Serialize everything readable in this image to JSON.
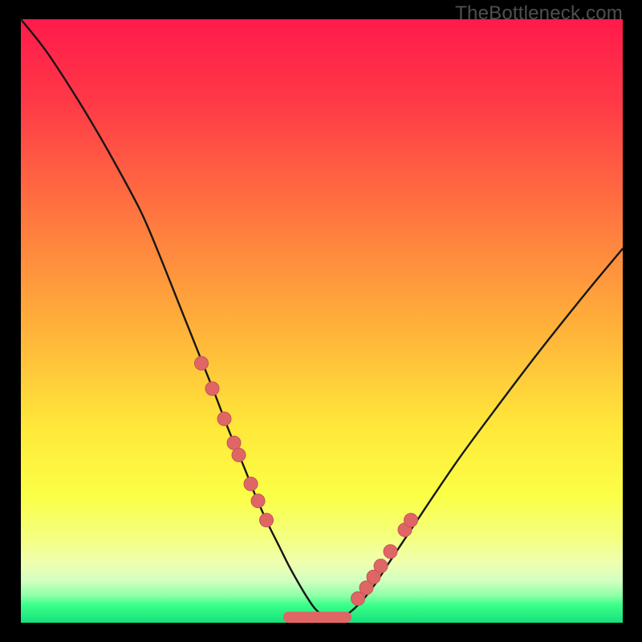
{
  "watermark": "TheBottleneck.com",
  "colors": {
    "frame_bg": "#000000",
    "gradient_stops": [
      {
        "pct": 0,
        "color": "#ff1a4b"
      },
      {
        "pct": 14,
        "color": "#ff3a47"
      },
      {
        "pct": 34,
        "color": "#ff7b3f"
      },
      {
        "pct": 52,
        "color": "#ffb43a"
      },
      {
        "pct": 68,
        "color": "#ffe93a"
      },
      {
        "pct": 79,
        "color": "#fbff46"
      },
      {
        "pct": 86,
        "color": "#f4ff80"
      },
      {
        "pct": 90,
        "color": "#efffaf"
      },
      {
        "pct": 93,
        "color": "#d3ffc1"
      },
      {
        "pct": 95.5,
        "color": "#8effa7"
      },
      {
        "pct": 97,
        "color": "#3dff8b"
      },
      {
        "pct": 100,
        "color": "#15e27a"
      }
    ],
    "curve_stroke": "#161616",
    "marker_fill": "#e06666",
    "marker_stroke": "#c25555",
    "flat_segment": "#e06666"
  },
  "chart_data": {
    "type": "line",
    "title": "",
    "xlabel": "",
    "ylabel": "",
    "xlim": [
      0,
      100
    ],
    "ylim": [
      0,
      100
    ],
    "grid": false,
    "legend": false,
    "series": [
      {
        "name": "bottleneck-curve",
        "x": [
          0,
          4,
          8,
          12,
          16,
          20,
          23,
          26,
          29,
          32,
          34.5,
          37,
          39,
          41,
          43,
          44.5,
          46,
          47.5,
          49,
          51,
          53,
          55,
          57,
          59,
          61,
          64,
          68,
          73,
          79,
          86,
          94,
          100
        ],
        "y": [
          100,
          95,
          89,
          82.5,
          75.5,
          68,
          61,
          53.5,
          46,
          38.5,
          32,
          26,
          21,
          16.5,
          12.5,
          9.5,
          6.8,
          4.3,
          2.2,
          0.7,
          0.7,
          2.0,
          4.0,
          6.6,
          9.7,
          14.2,
          20.2,
          27.5,
          35.6,
          44.8,
          54.8,
          62.0
        ]
      }
    ],
    "flat_bottom": {
      "x0": 44.5,
      "x1": 54.0,
      "y": 0.9
    },
    "markers": {
      "name": "highlighted-points",
      "x": [
        30.0,
        31.8,
        33.8,
        35.4,
        36.2,
        38.2,
        39.4,
        40.8,
        56.0,
        57.4,
        58.6,
        59.8,
        61.4,
        63.8,
        64.8
      ],
      "y": [
        43.0,
        38.8,
        33.8,
        29.8,
        27.8,
        23.0,
        20.2,
        17.0,
        4.0,
        5.8,
        7.6,
        9.4,
        11.8,
        15.4,
        17.0
      ]
    }
  }
}
